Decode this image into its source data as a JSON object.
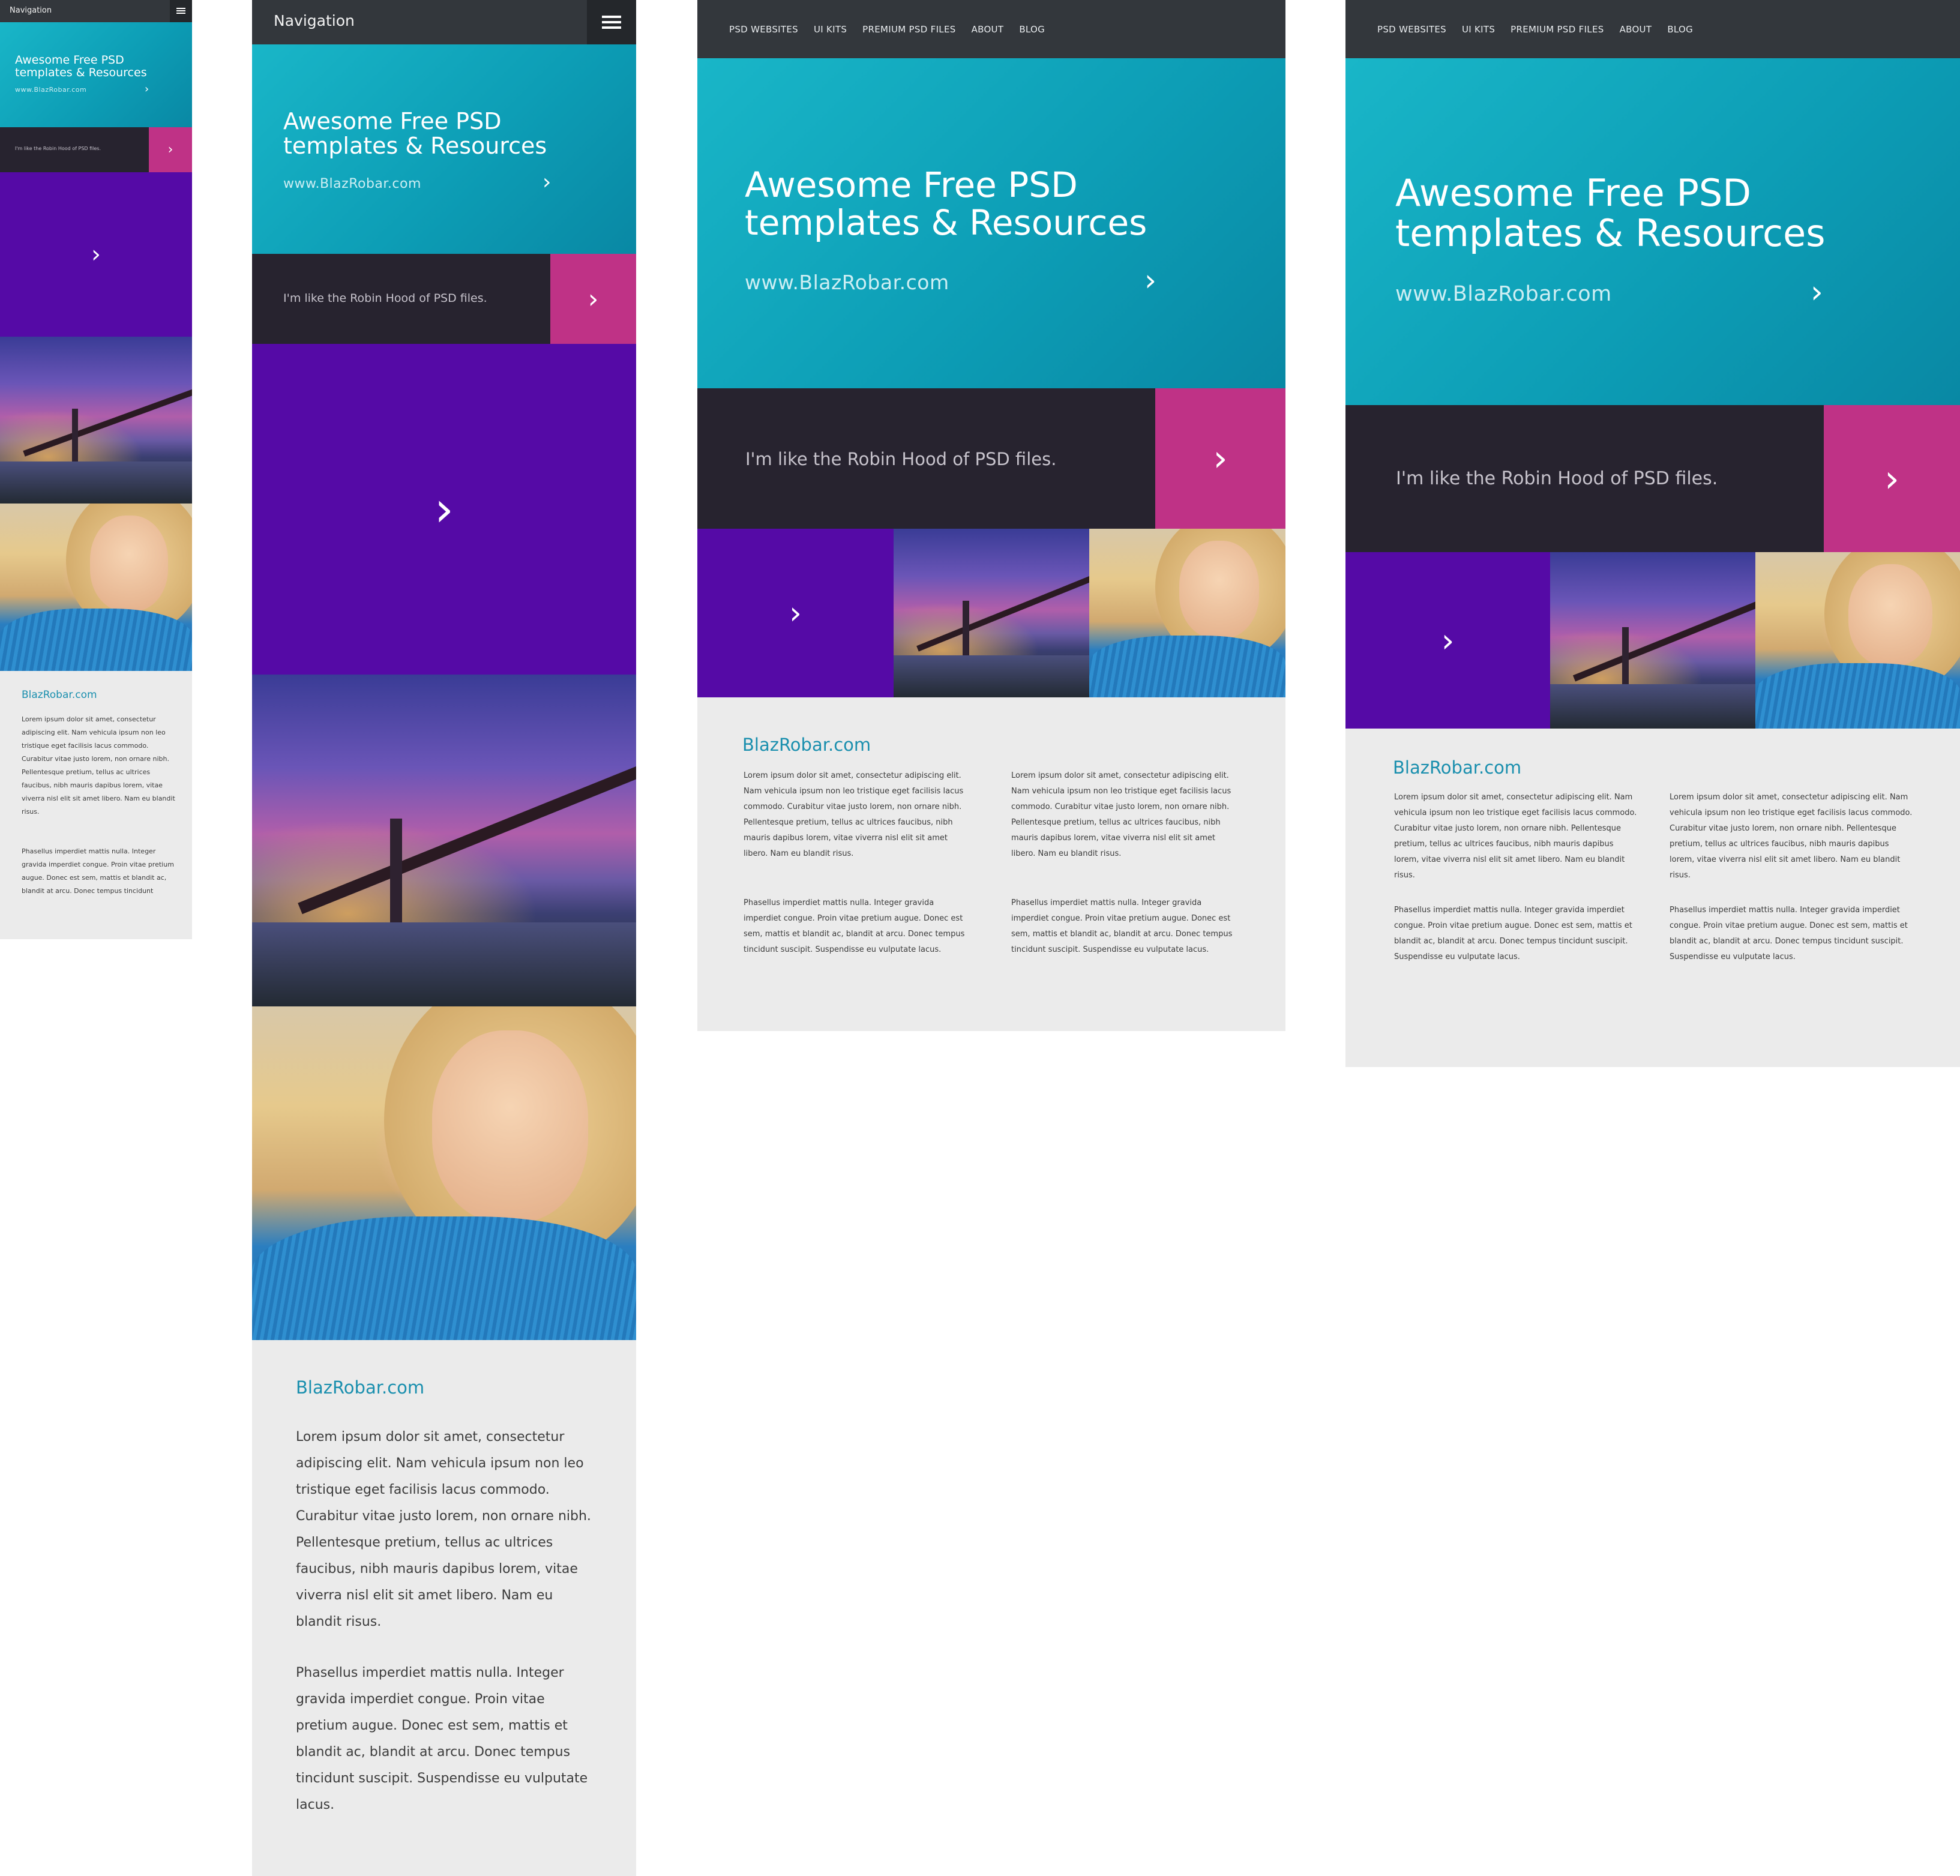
{
  "mobile_nav": {
    "title": "Navigation",
    "menu_icon": "hamburger-menu-icon"
  },
  "desktop_nav": {
    "links": [
      "PSD WEBSITES",
      "UI KITS",
      "PREMIUM PSD FILES",
      "ABOUT",
      "BLOG"
    ]
  },
  "hero": {
    "title_line1": "Awesome Free PSD",
    "title_line2": "templates & Resources",
    "url": "www.BlazRobar.com",
    "arrow_icon": "chevron-right-icon"
  },
  "tagline": {
    "text": "I'm like the Robin Hood of PSD files.",
    "arrow": "›"
  },
  "content": {
    "site_name": "BlazRobar.com",
    "paragraph1": "Lorem ipsum dolor sit amet, consectetur adipiscing elit. Nam vehicula ipsum non leo tristique eget facilisis lacus commodo. Curabitur vitae justo lorem, non ornare nibh. Pellentesque pretium, tellus ac ultrices faucibus, nibh mauris dapibus lorem, vitae viverra nisl elit sit amet libero. Nam eu blandit risus.",
    "paragraph2": "Phasellus imperdiet mattis nulla. Integer gravida imperdiet congue. Proin vitae pretium augue. Donec est sem, mattis et blandit ac, blandit at arcu. Donec tempus tincidunt suscipit. Suspendisse eu vulputate lacus.",
    "paragraph2_truncated": "Phasellus imperdiet mattis nulla. Integer gravida imperdiet congue. Proin vitae pretium augue. Donec est sem, mattis et blandit ac, blandit at arcu. Donec tempus tincidunt"
  },
  "colors": {
    "nav": "#33373c",
    "hero": "#13a8bf",
    "tagline": "#27232f",
    "magenta": "#bf3286",
    "purple": "#550aa6",
    "content_bg": "#ebebeb",
    "site_name": "#1a8fae"
  },
  "chevron": "›"
}
